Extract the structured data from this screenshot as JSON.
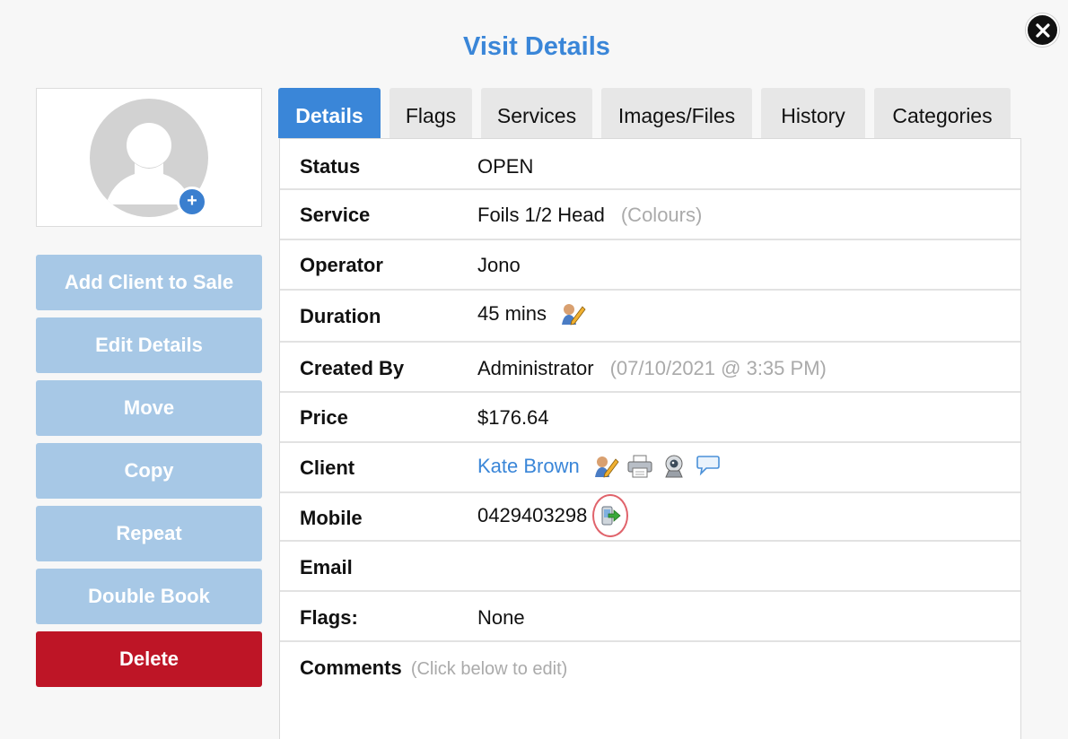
{
  "page": {
    "title": "Visit Details"
  },
  "sidebar": {
    "buttons": [
      {
        "label": "Add Client to Sale"
      },
      {
        "label": "Edit Details"
      },
      {
        "label": "Move"
      },
      {
        "label": "Copy"
      },
      {
        "label": "Repeat"
      },
      {
        "label": "Double Book"
      },
      {
        "label": "Delete"
      }
    ],
    "avatar_add_glyph": "+"
  },
  "tabs": [
    {
      "label": "Details",
      "active": true
    },
    {
      "label": "Flags"
    },
    {
      "label": "Services"
    },
    {
      "label": "Images/Files"
    },
    {
      "label": "History"
    },
    {
      "label": "Categories"
    }
  ],
  "details": {
    "status": {
      "label": "Status",
      "value": "OPEN"
    },
    "service": {
      "label": "Service",
      "value": "Foils 1/2 Head",
      "note": "(Colours)"
    },
    "operator": {
      "label": "Operator",
      "value": "Jono"
    },
    "duration": {
      "label": "Duration",
      "value": "45 mins",
      "icon": "edit-person-icon"
    },
    "created_by": {
      "label": "Created By",
      "value": "Administrator",
      "note": "(07/10/2021 @ 3:35 PM)"
    },
    "price": {
      "label": "Price",
      "value": "$176.64"
    },
    "client": {
      "label": "Client",
      "value": "Kate Brown",
      "icons": [
        "edit-person-icon",
        "printer-icon",
        "webcam-icon",
        "message-icon"
      ]
    },
    "mobile": {
      "label": "Mobile",
      "value": "0429403298",
      "icon": "send-sms-icon"
    },
    "email": {
      "label": "Email",
      "value": ""
    },
    "flags": {
      "label": "Flags:",
      "value": "None"
    },
    "comments": {
      "label": "Comments",
      "note": "(Click below to edit)"
    }
  },
  "colors": {
    "accent": "#3a86d8",
    "sidebar_button": "#a7c8e6",
    "delete_button": "#be1526",
    "highlight": "#e0636b"
  }
}
